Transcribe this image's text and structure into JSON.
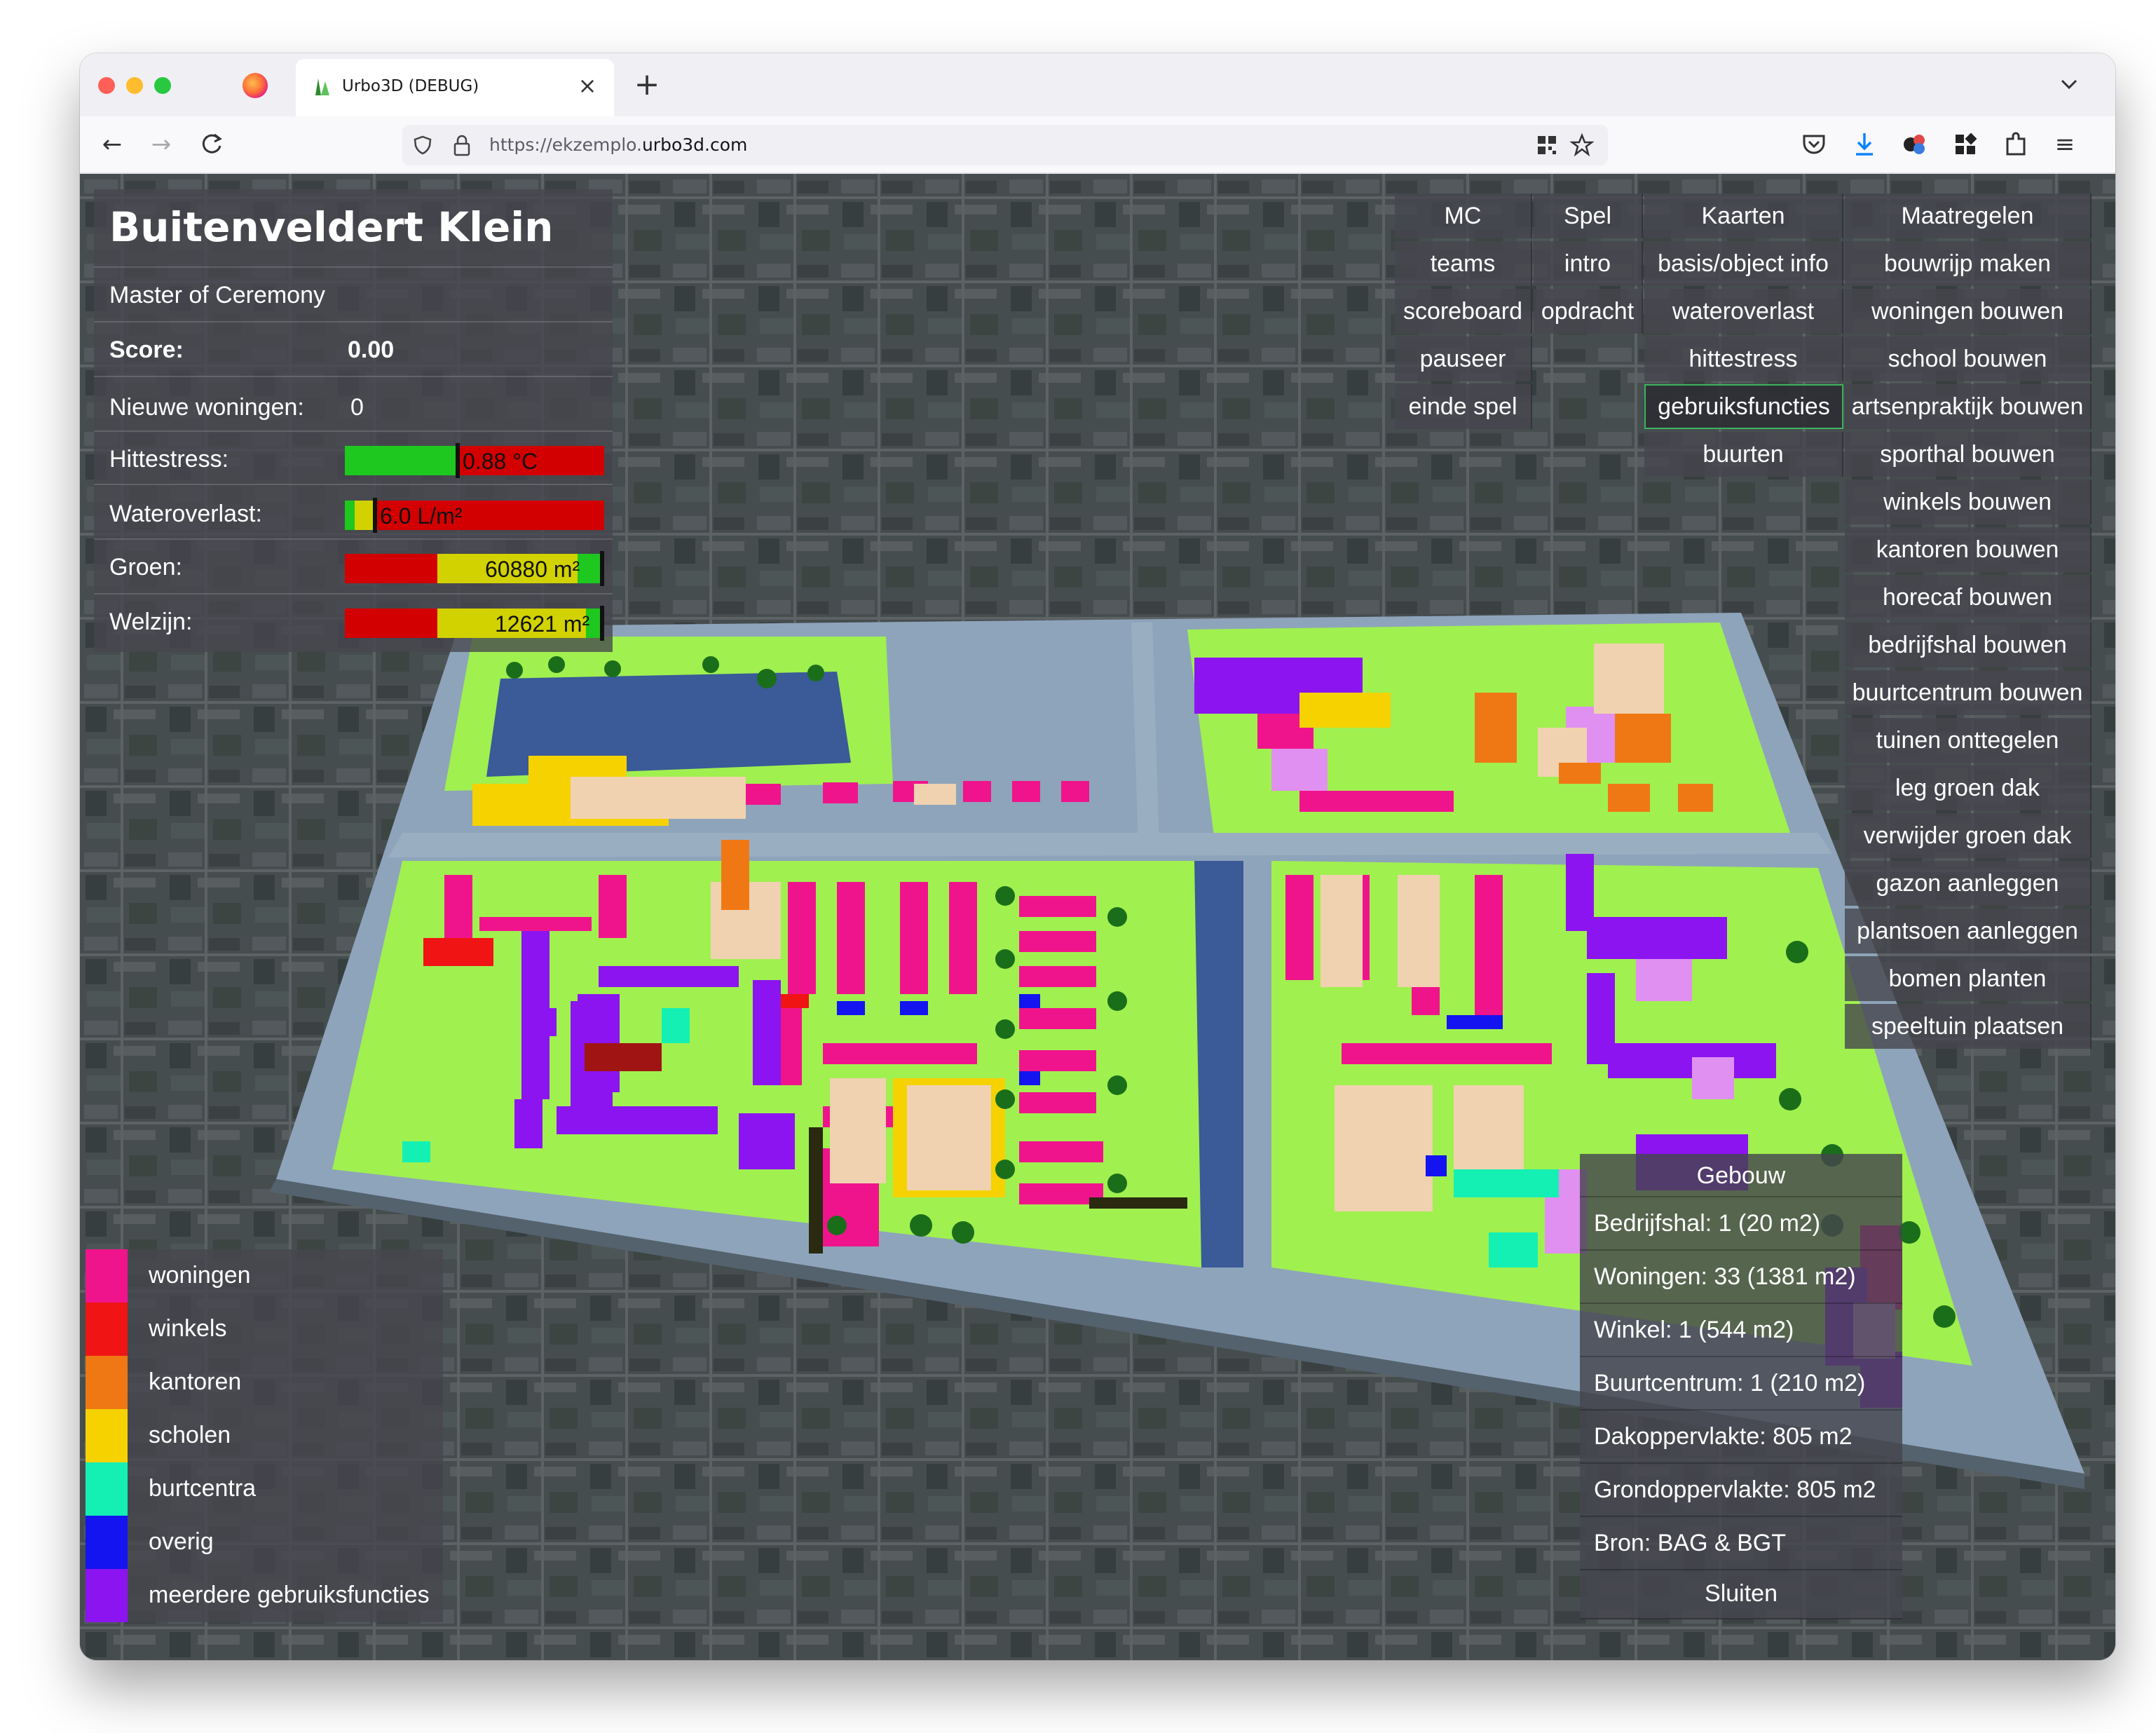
{
  "browser": {
    "tab_title": "Urbo3D (DEBUG)",
    "url_prefix": "https://ekzemplo.",
    "url_domain": "urbo3d.com",
    "new_tab_label": "+",
    "close_tab_label": "×"
  },
  "hud": {
    "title": "Buitenveldert Klein",
    "role": "Master of Ceremony",
    "score_label": "Score:",
    "score_value": "0.00",
    "new_homes_label": "Nieuwe woningen:",
    "new_homes_value": "0",
    "heat_label": "Hittestress:",
    "heat_value": "0.88 °C",
    "water_label": "Wateroverlast:",
    "water_value": "6.0 L/m²",
    "green_label": "Groen:",
    "green_value": "60880 m²",
    "welfare_label": "Welzijn:",
    "welfare_value": "12621 m²"
  },
  "menu": {
    "mc": {
      "header": "MC",
      "items": [
        "teams",
        "scoreboard",
        "pauseer",
        "einde spel"
      ]
    },
    "spel": {
      "header": "Spel",
      "items": [
        "intro",
        "opdracht"
      ]
    },
    "kaarten": {
      "header": "Kaarten",
      "items": [
        "basis/object info",
        "wateroverlast",
        "hittestress",
        "gebruiksfuncties",
        "buurten"
      ],
      "active": "gebruiksfuncties"
    },
    "maatregelen": {
      "header": "Maatregelen",
      "items": [
        "bouwrijp maken",
        "woningen bouwen",
        "school bouwen",
        "artsenpraktijk bouwen",
        "sporthal bouwen",
        "winkels bouwen",
        "kantoren bouwen",
        "horecaf bouwen",
        "bedrijfshal bouwen",
        "buurtcentrum bouwen",
        "tuinen onttegelen",
        "leg groen dak",
        "verwijder groen dak",
        "gazon aanleggen",
        "plantsoen aanleggen",
        "bomen planten",
        "speeltuin plaatsen"
      ]
    }
  },
  "legend": [
    {
      "label": "woningen",
      "color": "#f0148c"
    },
    {
      "label": "winkels",
      "color": "#f01414"
    },
    {
      "label": "kantoren",
      "color": "#f07814"
    },
    {
      "label": "scholen",
      "color": "#f5d200"
    },
    {
      "label": "burtcentra",
      "color": "#14f0b4"
    },
    {
      "label": "overig",
      "color": "#1414f0"
    },
    {
      "label": "meerdere gebruiksfuncties",
      "color": "#8c14f0"
    }
  ],
  "info": {
    "header": "Gebouw",
    "rows": [
      "Bedrijfshal: 1 (20 m2)",
      "Woningen: 33 (1381 m2)",
      "Winkel: 1 (544 m2)",
      "Buurtcentrum: 1 (210 m2)",
      "Dakoppervlakte: 805 m2",
      "Grondoppervlakte: 805 m2",
      "Bron: BAG & BGT"
    ],
    "close": "Sluiten"
  },
  "colors": {
    "meter_green": "#1ec81e",
    "meter_red": "#d20000",
    "meter_yellow": "#d2d200",
    "active_border": "#3bb45c"
  }
}
